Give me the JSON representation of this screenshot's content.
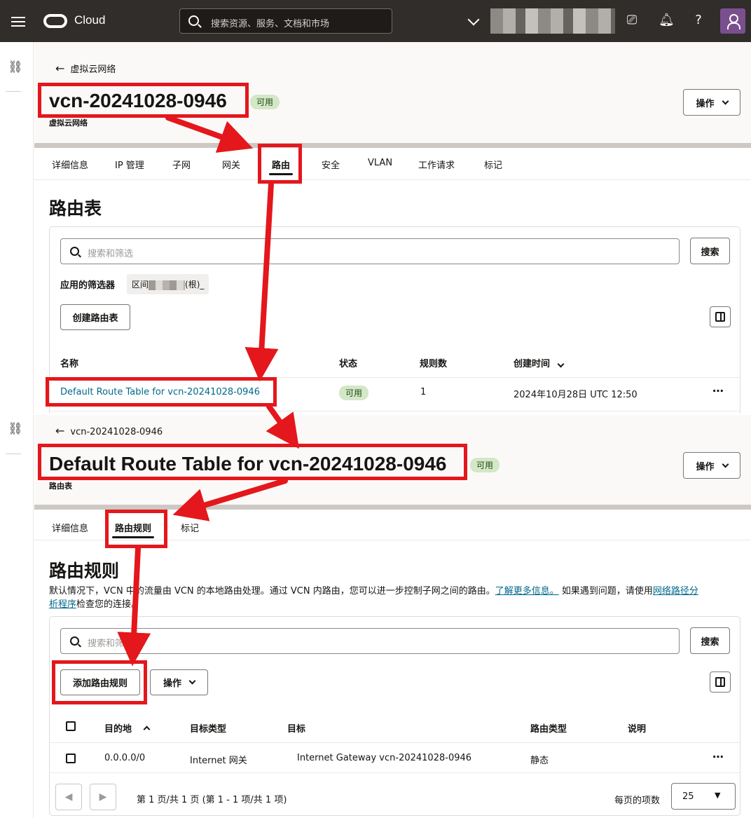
{
  "topbar": {
    "brand": "Cloud",
    "search_placeholder": "搜索资源、服务、文档和市场"
  },
  "screen1": {
    "back_label": "虚拟云网络",
    "title": "vcn-20241028-0946",
    "status": "可用",
    "subtype": "虚拟云网络",
    "actions_label": "操作",
    "tabs": [
      "详细信息",
      "IP 管理",
      "子网",
      "网关",
      "路由",
      "安全",
      "VLAN",
      "工作请求",
      "标记"
    ],
    "active_tab": "路由",
    "section_title": "路由表",
    "search_placeholder": "搜索和筛选",
    "search_button": "搜索",
    "applied_filters_label": "应用的筛选器",
    "filter_chip_prefix": "区间",
    "filter_chip_suffix": "(根)_",
    "create_button": "创建路由表",
    "columns": [
      "名称",
      "状态",
      "规则数",
      "创建时间"
    ],
    "rows": [
      {
        "name": "Default Route Table for vcn-20241028-0946",
        "status": "可用",
        "rules": "1",
        "created": "2024年10月28日 UTC 12:50"
      }
    ]
  },
  "screen2": {
    "back_label": "vcn-20241028-0946",
    "title": "Default Route Table for vcn-20241028-0946",
    "status": "可用",
    "subtype": "路由表",
    "actions_label": "操作",
    "tabs": [
      "详细信息",
      "路由规则",
      "标记"
    ],
    "active_tab": "路由规则",
    "section_title": "路由规则",
    "desc_part1": "默认情况下，VCN 中的流量由 VCN 的本地路由处理。通过 VCN 内路由，您可以进一步控制子网之间的路由。",
    "desc_link1": "了解更多信息。",
    "desc_part2": " 如果遇到问题，请使用",
    "desc_link2a": "网络路径分",
    "desc_link2b": "析程序",
    "desc_part3": "检查您的连接。",
    "search_placeholder": "搜索和筛选",
    "search_button": "搜索",
    "add_button": "添加路由规则",
    "actions2_label": "操作",
    "columns": [
      "目的地",
      "目标类型",
      "目标",
      "路由类型",
      "说明"
    ],
    "rows": [
      {
        "destination": "0.0.0.0/0",
        "target_type": "Internet 网关",
        "target": "Internet Gateway vcn-20241028-0946",
        "route_type": "静态",
        "description": ""
      }
    ],
    "pager_text": "第 1 页/共 1 页 (第 1 - 1 项/共 1 项)",
    "per_page_label": "每页的项数",
    "per_page_value": "25"
  },
  "colors": {
    "annotation": "#e4171c",
    "link": "#00688c",
    "badge_bg": "#d4e7c6",
    "topbar": "#312d2a"
  }
}
